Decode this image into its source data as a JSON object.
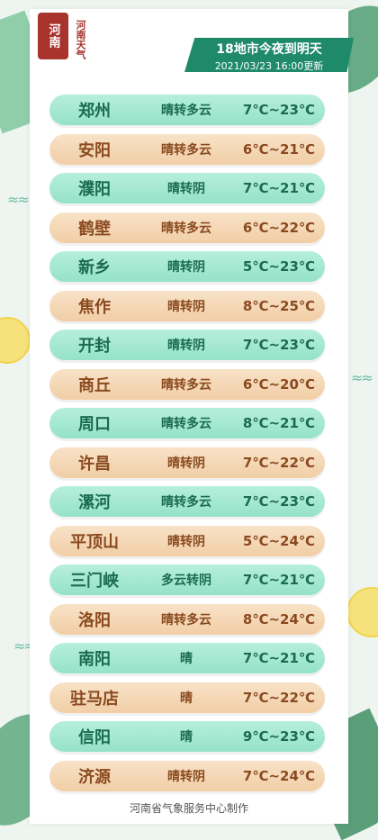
{
  "logo": {
    "seal": "河南",
    "side_text": "河南天气"
  },
  "banner": {
    "title": "18地市今夜到明天",
    "subtitle": "2021/03/23 16:00更新"
  },
  "rows": [
    {
      "city": "郑州",
      "weather": "晴转多云",
      "temp": "7℃~23℃"
    },
    {
      "city": "安阳",
      "weather": "晴转多云",
      "temp": "6℃~21℃"
    },
    {
      "city": "濮阳",
      "weather": "晴转阴",
      "temp": "7℃~21℃"
    },
    {
      "city": "鹤壁",
      "weather": "晴转多云",
      "temp": "6℃~22℃"
    },
    {
      "city": "新乡",
      "weather": "晴转阴",
      "temp": "5℃~23℃"
    },
    {
      "city": "焦作",
      "weather": "晴转阴",
      "temp": "8℃~25℃"
    },
    {
      "city": "开封",
      "weather": "晴转阴",
      "temp": "7℃~23℃"
    },
    {
      "city": "商丘",
      "weather": "晴转多云",
      "temp": "6℃~20℃"
    },
    {
      "city": "周口",
      "weather": "晴转多云",
      "temp": "8℃~21℃"
    },
    {
      "city": "许昌",
      "weather": "晴转阴",
      "temp": "7℃~22℃"
    },
    {
      "city": "漯河",
      "weather": "晴转多云",
      "temp": "7℃~23℃"
    },
    {
      "city": "平顶山",
      "weather": "晴转阴",
      "temp": "5℃~24℃"
    },
    {
      "city": "三门峡",
      "weather": "多云转阴",
      "temp": "7℃~21℃"
    },
    {
      "city": "洛阳",
      "weather": "晴转多云",
      "temp": "8℃~24℃"
    },
    {
      "city": "南阳",
      "weather": "晴",
      "temp": "7℃~21℃"
    },
    {
      "city": "驻马店",
      "weather": "晴",
      "temp": "7℃~22℃"
    },
    {
      "city": "信阳",
      "weather": "晴",
      "temp": "9℃~23℃"
    },
    {
      "city": "济源",
      "weather": "晴转阴",
      "temp": "7℃~24℃"
    }
  ],
  "footer": "河南省气象服务中心制作",
  "colors": {
    "green_row": "#a6e9d2",
    "orange_row": "#f4d8b6",
    "banner": "#1f8a6a",
    "seal": "#a8342d"
  }
}
